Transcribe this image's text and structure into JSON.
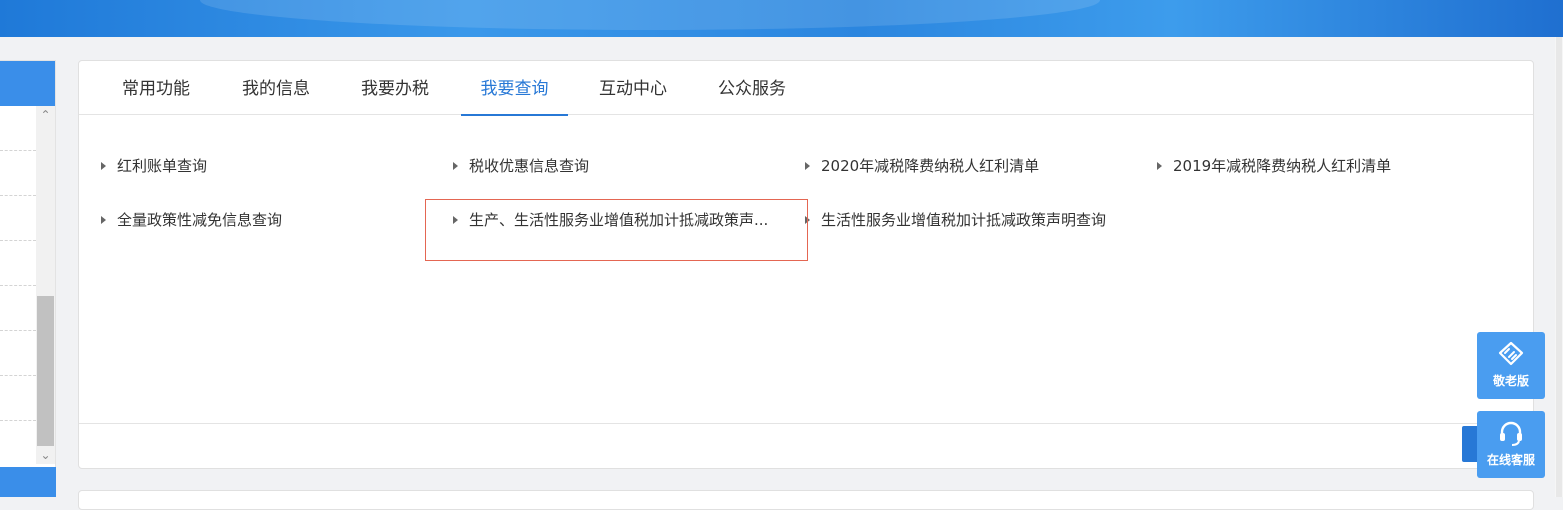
{
  "tabs": [
    {
      "label": "常用功能",
      "active": false
    },
    {
      "label": "我的信息",
      "active": false
    },
    {
      "label": "我要办税",
      "active": false
    },
    {
      "label": "我要查询",
      "active": true
    },
    {
      "label": "互动中心",
      "active": false
    },
    {
      "label": "公众服务",
      "active": false
    }
  ],
  "query_items": [
    "红利账单查询",
    "税收优惠信息查询",
    "2020年减税降费纳税人红利清单",
    "2019年减税降费纳税人红利清单",
    "全量政策性减免信息查询",
    "生产、生活性服务业增值税加计抵减政策声...",
    "生活性服务业增值税加计抵减政策声明查询"
  ],
  "float_buttons": {
    "elderly_mode": "敬老版",
    "online_service": "在线客服"
  },
  "colors": {
    "accent": "#2778d6",
    "highlight_border": "#e46652",
    "banner": "#2b86df",
    "float_button": "#4a9df0"
  },
  "icons": [
    "arrow-right-icon",
    "handshake-icon",
    "headset-icon",
    "chevron-up-icon",
    "chevron-down-icon"
  ]
}
